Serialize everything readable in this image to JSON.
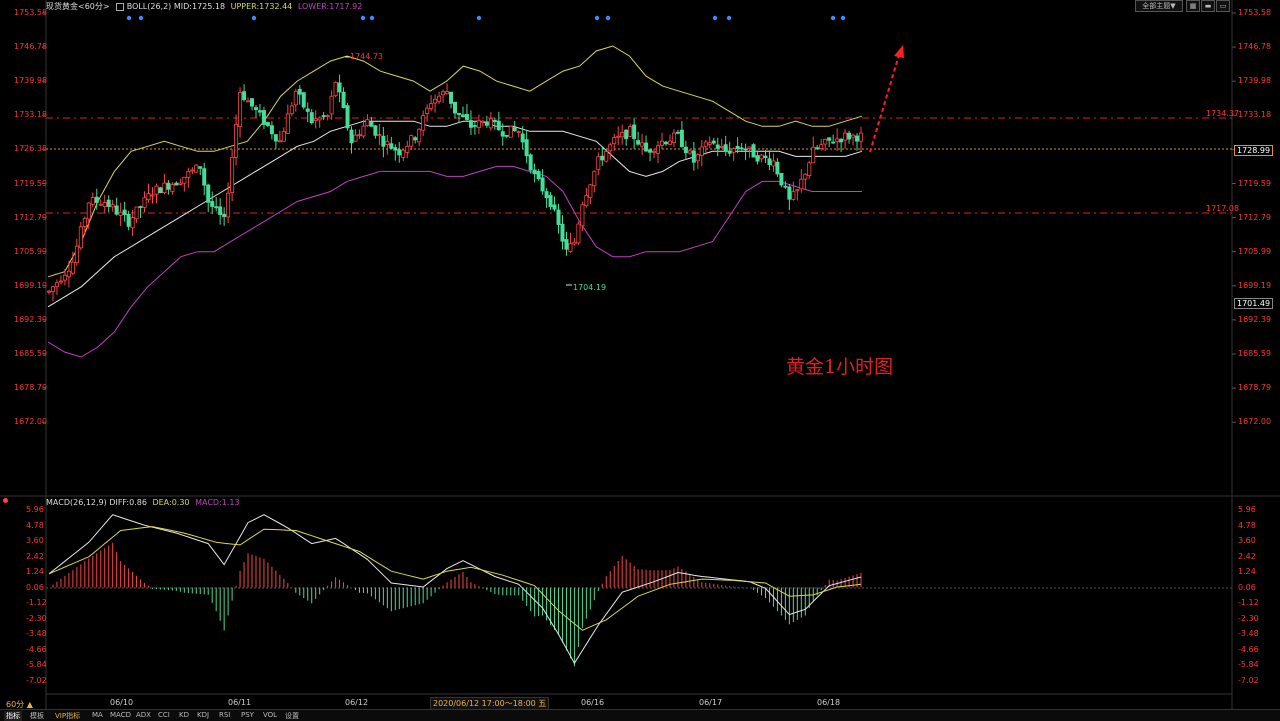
{
  "header": {
    "symbol": "现货黄金<60分>",
    "indicator": "BOLL(26,2)",
    "mid": "MID:1725.18",
    "upper": "UPPER:1732.44",
    "lower": "LOWER:1717.92",
    "main_button": "全部主题",
    "main_button_arrow": "▼"
  },
  "price_axis": [
    "1753.58",
    "1746.78",
    "1739.98",
    "1733.18",
    "1726.38",
    "1719.59",
    "1712.79",
    "1705.99",
    "1699.19",
    "1692.39",
    "1685.59",
    "1678.79",
    "1672.00"
  ],
  "price_axis_right": [
    "1753.58",
    "1746.78",
    "1739.98",
    "1733.18",
    "1726.38",
    "1719.59",
    "1712.79",
    "1705.99",
    "1699.19",
    "1692.39",
    "1685.59",
    "1678.79",
    "1672.00"
  ],
  "levels": {
    "resistance": "1734.37",
    "current": "1728.99",
    "support": "1717.08",
    "marker": "1701.49"
  },
  "annotations": {
    "high_label": "1744.73",
    "low_label": "1704.19",
    "chart_title": "黄金1小时图"
  },
  "macd": {
    "header": "MACD(26,12,9)",
    "diff": "DIFF:0.86",
    "dea": "DEA:0.30",
    "macd": "MACD:1.13",
    "axis": [
      "5.96",
      "4.78",
      "3.60",
      "2.42",
      "1.24",
      "0.06",
      "-1.12",
      "-2.30",
      "-3.48",
      "-4.66",
      "-5.84",
      "-7.02"
    ]
  },
  "dates": [
    "06/10",
    "06/11",
    "06/12",
    "06/16",
    "06/17",
    "06/18"
  ],
  "cursor_time": "2020/06/12 17:00～18:00 五",
  "period": "60分 ▲",
  "tabs": [
    "指标",
    "模板",
    "VIP指标",
    "MA",
    "MACD",
    "ADX",
    "CCI",
    "KD",
    "KDJ",
    "RSI",
    "PSY",
    "VOL",
    "设置"
  ],
  "colors": {
    "up": "#ff4444",
    "down": "#44dd99",
    "boll_upper": "#d9d94a",
    "boll_mid": "#e8e8e8",
    "boll_lower": "#c040c0",
    "axis_red": "#ff3333",
    "dea": "#d9d94a",
    "diff": "#e8e8e8"
  },
  "chart_data": {
    "type": "candlestick",
    "title": "黄金1小时图",
    "ylim": [
      1672.0,
      1753.58
    ],
    "series": [
      {
        "name": "BOLL UPPER",
        "values": [
          1701,
          1702,
          1708,
          1716,
          1722,
          1726,
          1727,
          1728,
          1727,
          1726,
          1726,
          1727,
          1728,
          1732,
          1737,
          1740,
          1742,
          1744,
          1745,
          1744,
          1742,
          1741,
          1740,
          1738,
          1740,
          1743,
          1742,
          1740,
          1739,
          1738,
          1740,
          1742,
          1743,
          1746,
          1747,
          1745,
          1741,
          1739,
          1738,
          1737,
          1736,
          1734,
          1732,
          1731,
          1731,
          1732,
          1731,
          1731,
          1732,
          1733
        ]
      },
      {
        "name": "BOLL MID",
        "values": [
          1695,
          1697,
          1699,
          1702,
          1705,
          1707,
          1709,
          1711,
          1713,
          1715,
          1717,
          1719,
          1721,
          1723,
          1725,
          1727,
          1728,
          1730,
          1731,
          1732,
          1732,
          1732,
          1732,
          1731,
          1731,
          1732,
          1732,
          1731,
          1731,
          1730,
          1730,
          1730,
          1729,
          1728,
          1725,
          1722,
          1721,
          1722,
          1724,
          1725,
          1726,
          1726,
          1726,
          1726,
          1726,
          1725,
          1725,
          1725,
          1725,
          1726
        ]
      },
      {
        "name": "BOLL LOWER",
        "values": [
          1688,
          1686,
          1685,
          1687,
          1690,
          1695,
          1699,
          1702,
          1705,
          1706,
          1706,
          1708,
          1710,
          1712,
          1714,
          1716,
          1717,
          1718,
          1720,
          1721,
          1722,
          1722,
          1722,
          1722,
          1721,
          1721,
          1722,
          1723,
          1723,
          1722,
          1721,
          1718,
          1712,
          1707,
          1705,
          1705,
          1706,
          1706,
          1706,
          1707,
          1708,
          1713,
          1718,
          1720,
          1720,
          1719,
          1718,
          1718,
          1718,
          1718
        ]
      }
    ],
    "high": 1744.73,
    "low": 1704.19,
    "resistance": 1734.37,
    "support": 1717.08,
    "current": 1728.99
  }
}
